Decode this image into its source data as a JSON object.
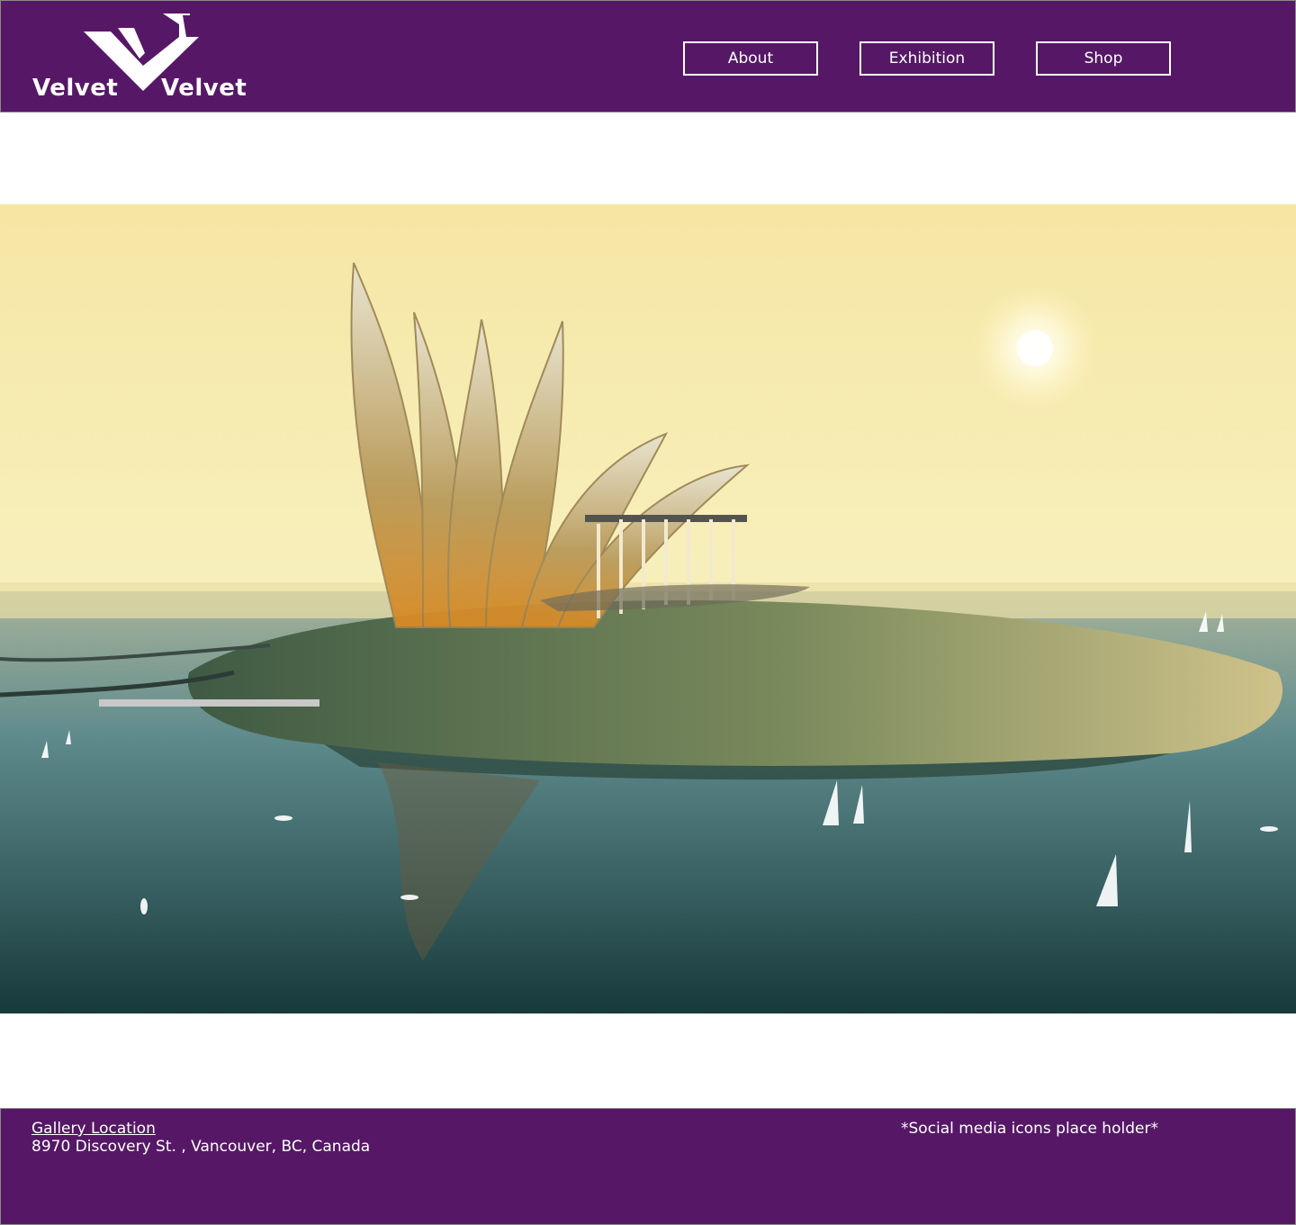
{
  "header": {
    "logo": {
      "word_left": "Velvet",
      "word_right": "Velvet",
      "icon": "velvet-v-logo-icon"
    },
    "nav": [
      {
        "label": "About"
      },
      {
        "label": "Exhibition"
      },
      {
        "label": "Shop"
      }
    ]
  },
  "hero": {
    "image": "futuristic-island-architecture-render",
    "alt": ""
  },
  "footer": {
    "location_title": "Gallery Location",
    "address": "8970 Discovery St. , Vancouver, BC, Canada",
    "social_placeholder": "*Social media icons place holder*"
  },
  "colors": {
    "brand_purple": "#561866",
    "text": "#ffffff"
  }
}
